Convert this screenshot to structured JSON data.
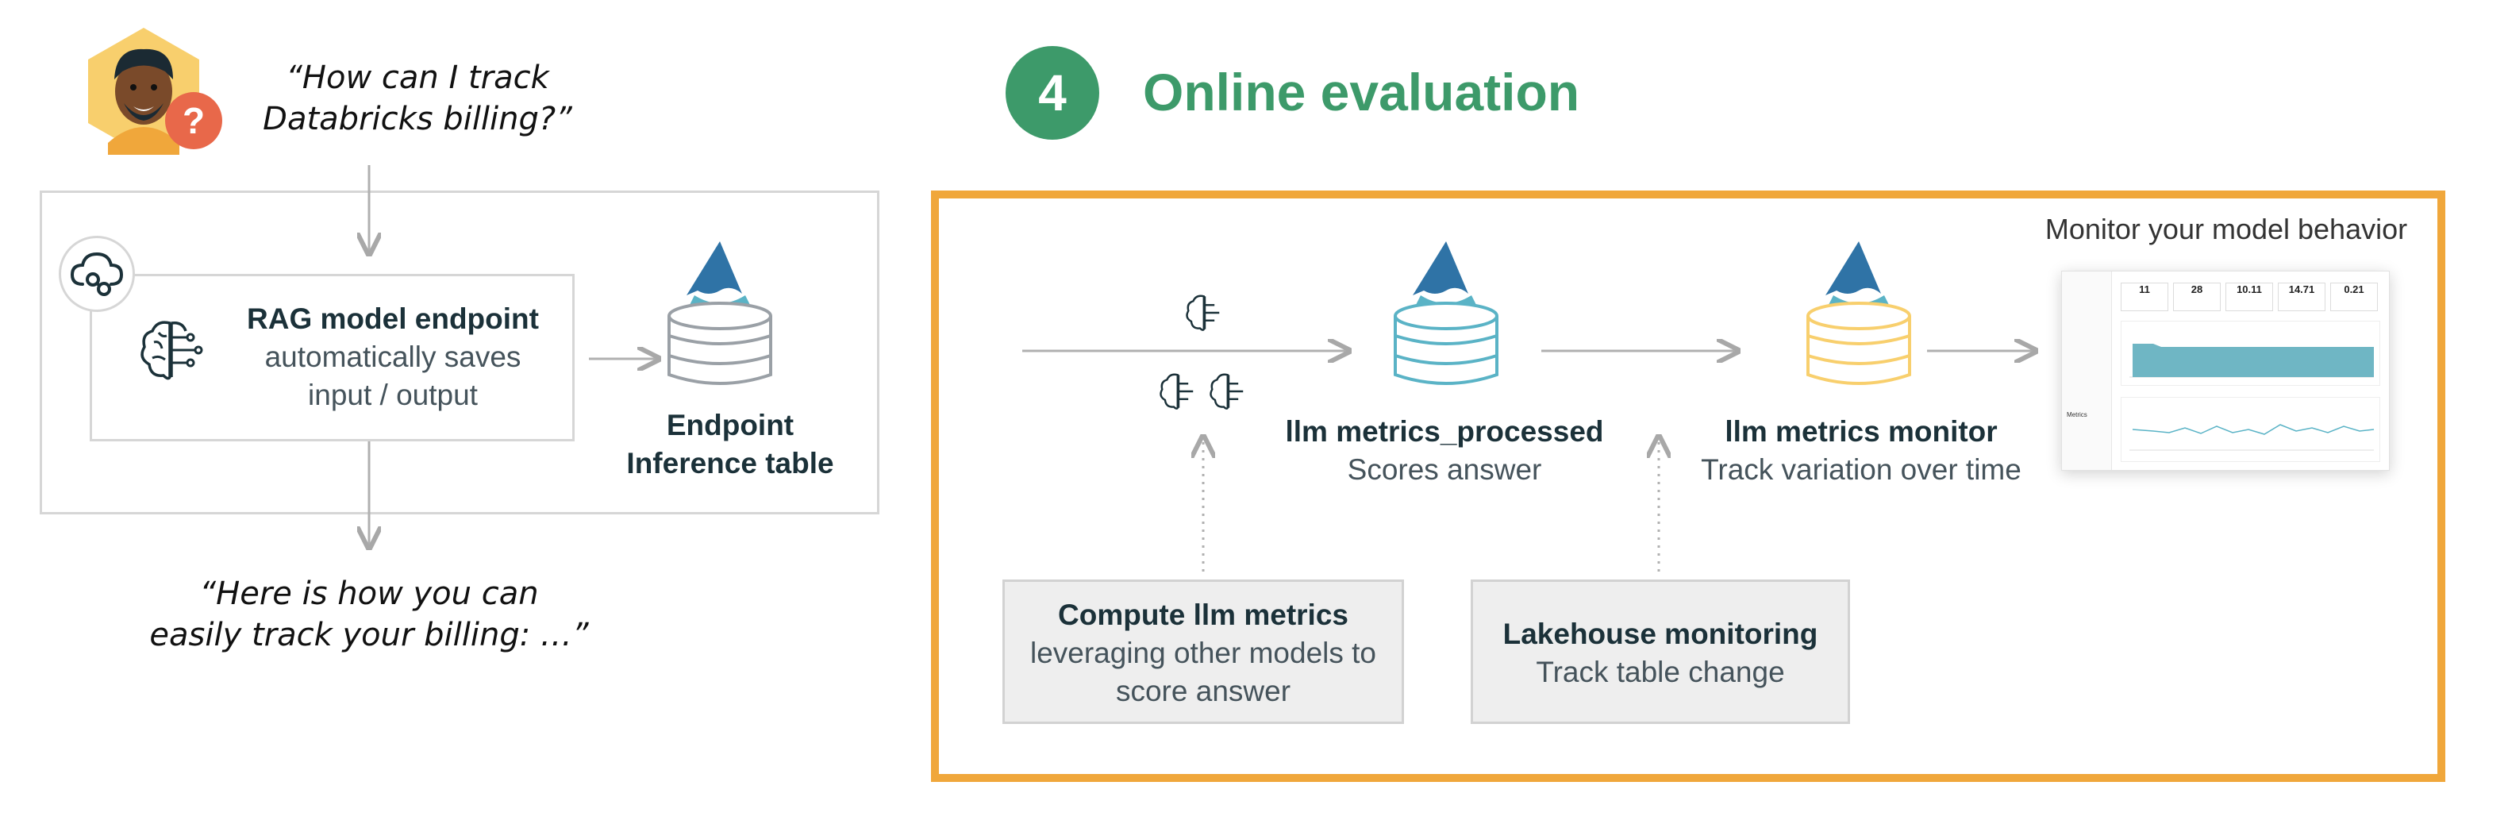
{
  "user_question": [
    "“How can I track",
    "Databricks billing?”"
  ],
  "answer_quote": [
    "“Here is how you can",
    "easily track your billing: …”"
  ],
  "rag_endpoint": {
    "title": "RAG model endpoint",
    "subtitle": [
      "automatically saves",
      "input / output"
    ]
  },
  "inference_table": {
    "title": [
      "Endpoint",
      "Inference table"
    ]
  },
  "step": {
    "number": "4",
    "title": "Online evaluation"
  },
  "metrics_processed": {
    "title": "llm metrics_processed",
    "subtitle": "Scores answer"
  },
  "metrics_monitor": {
    "title": "llm metrics monitor",
    "subtitle": "Track variation over time"
  },
  "monitor_caption": "Monitor your model behavior",
  "compute_box": {
    "title": "Compute llm metrics",
    "subtitle": [
      "leveraging other models to",
      "score answer"
    ]
  },
  "lakehouse_box": {
    "title": "Lakehouse monitoring",
    "subtitle": "Track table change"
  },
  "dashboard": {
    "kpis": [
      "11",
      "28",
      "10.11",
      "14.71",
      "0.21"
    ],
    "section_label": "Metrics"
  },
  "colors": {
    "accent_green": "#3d9a6a",
    "accent_orange": "#f0a73b",
    "db_teal": "#5ab3c6",
    "db_yellow": "#f8cf6d",
    "db_grey": "#9aa0a6",
    "logo_blue": "#2f73a6"
  }
}
